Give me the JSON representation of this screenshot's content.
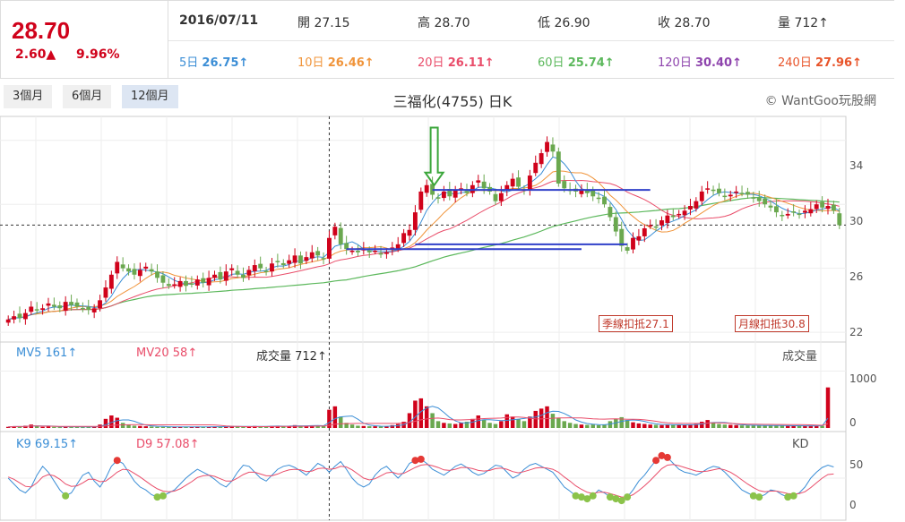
{
  "quote": {
    "price": "28.70",
    "change": "2.60▲",
    "percent": "9.96%"
  },
  "info": {
    "date": "2016/07/11",
    "open": "開 27.15",
    "high": "高 28.70",
    "low": "低 26.90",
    "close": "收 28.70",
    "volume": "量 712↑"
  },
  "ma": [
    {
      "label": "5日",
      "value": "26.75↑",
      "color": "#3b8ed6"
    },
    {
      "label": "10日",
      "value": "26.46↑",
      "color": "#f0943a"
    },
    {
      "label": "20日",
      "value": "26.11↑",
      "color": "#e94d6a"
    },
    {
      "label": "60日",
      "value": "25.74↑",
      "color": "#5cb85c"
    },
    {
      "label": "120日",
      "value": "30.40↑",
      "color": "#8e44ad"
    },
    {
      "label": "240日",
      "value": "27.96↑",
      "color": "#e8542a"
    }
  ],
  "tabs": [
    "3個月",
    "6個月",
    "12個月"
  ],
  "title": "三福化(4755) 日K",
  "brand": "© WantGoo玩股網",
  "notes": {
    "quarter": "季線扣抵27.1",
    "month": "月線扣抵30.8"
  },
  "volume_panel": {
    "mv5": "MV5 161↑",
    "mv20": "MV20 58↑",
    "vol": "成交量 712↑",
    "name": "成交量"
  },
  "kd_panel": {
    "k": "K9 69.15↑",
    "d": "D9 57.08↑",
    "name": "KD"
  },
  "colors": {
    "up": "#d0021b",
    "down": "#6aa84f",
    "annot": "#3140c9",
    "arrow": "#3aa63a"
  },
  "chart_data": {
    "type": "candlestick",
    "price_ticks": [
      "34",
      "30",
      "26",
      "22"
    ],
    "price_ylim": [
      21.5,
      35.5
    ],
    "volume_ticks": [
      "1000",
      "0"
    ],
    "kd_ticks": [
      "50",
      "0"
    ],
    "reference_price": 28.7,
    "close": [
      22.8,
      23.0,
      22.9,
      23.2,
      23.6,
      23.4,
      23.5,
      23.8,
      23.6,
      23.5,
      23.9,
      23.7,
      23.6,
      23.5,
      23.4,
      23.5,
      24.0,
      24.8,
      25.6,
      26.4,
      26.0,
      25.8,
      25.6,
      25.9,
      26.1,
      25.8,
      25.4,
      25.1,
      24.9,
      25.0,
      25.2,
      24.9,
      25.0,
      25.3,
      25.1,
      25.4,
      25.6,
      25.3,
      25.8,
      26.0,
      25.6,
      25.4,
      25.9,
      26.2,
      26.0,
      25.8,
      26.3,
      26.4,
      26.2,
      26.5,
      26.8,
      26.3,
      26.7,
      27.0,
      26.8,
      26.6,
      27.9,
      28.6,
      27.5,
      27.2,
      27.1,
      27.0,
      27.2,
      27.0,
      27.1,
      26.9,
      27.0,
      27.3,
      27.5,
      28.2,
      28.4,
      29.5,
      30.8,
      31.2,
      30.6,
      30.4,
      30.8,
      30.5,
      30.9,
      31.0,
      30.7,
      31.2,
      31.5,
      31.0,
      30.8,
      30.2,
      30.7,
      31.2,
      31.6,
      31.1,
      30.9,
      31.8,
      32.6,
      33.2,
      33.9,
      33.3,
      31.3,
      31.0,
      30.9,
      30.8,
      30.9,
      30.7,
      30.5,
      30.4,
      30.0,
      29.2,
      28.3,
      27.4,
      27.1,
      27.9,
      28.0,
      28.5,
      28.7,
      28.6,
      29.0,
      29.3,
      29.2,
      29.4,
      29.6,
      29.9,
      30.2,
      30.8,
      31.0,
      30.9,
      30.7,
      30.5,
      30.6,
      30.8,
      30.7,
      30.6,
      30.4,
      30.2,
      30.0,
      29.8,
      29.5,
      29.3,
      29.4,
      29.5,
      29.4,
      29.6,
      29.7,
      30.0,
      29.8,
      29.9,
      29.6,
      28.7
    ],
    "volume": [
      20,
      30,
      25,
      40,
      60,
      30,
      20,
      25,
      20,
      15,
      30,
      25,
      18,
      15,
      20,
      25,
      60,
      160,
      220,
      180,
      90,
      60,
      40,
      35,
      30,
      25,
      20,
      20,
      15,
      18,
      22,
      20,
      18,
      25,
      20,
      22,
      25,
      20,
      30,
      35,
      25,
      20,
      30,
      35,
      30,
      25,
      35,
      40,
      30,
      35,
      50,
      35,
      40,
      45,
      40,
      35,
      320,
      380,
      200,
      90,
      60,
      40,
      35,
      30,
      30,
      25,
      30,
      50,
      70,
      110,
      260,
      480,
      520,
      380,
      260,
      120,
      90,
      80,
      70,
      90,
      110,
      160,
      220,
      150,
      90,
      70,
      120,
      240,
      200,
      150,
      120,
      200,
      300,
      340,
      380,
      250,
      180,
      120,
      90,
      70,
      60,
      55,
      60,
      50,
      60,
      120,
      160,
      190,
      140,
      100,
      80,
      70,
      60,
      55,
      50,
      60,
      60,
      55,
      50,
      60,
      70,
      110,
      140,
      100,
      70,
      60,
      55,
      50,
      45,
      45,
      40,
      45,
      40,
      40,
      45,
      40,
      38,
      35,
      40,
      38,
      35,
      40,
      40,
      712
    ],
    "k": [
      50,
      40,
      30,
      25,
      35,
      55,
      70,
      60,
      45,
      30,
      20,
      25,
      40,
      55,
      60,
      45,
      35,
      50,
      70,
      80,
      75,
      60,
      45,
      35,
      30,
      22,
      18,
      20,
      25,
      30,
      40,
      50,
      58,
      65,
      60,
      55,
      48,
      40,
      35,
      45,
      60,
      72,
      70,
      60,
      50,
      45,
      55,
      65,
      70,
      72,
      68,
      62,
      55,
      65,
      75,
      70,
      60,
      70,
      78,
      65,
      50,
      40,
      35,
      40,
      55,
      65,
      70,
      60,
      50,
      60,
      75,
      80,
      82,
      75,
      65,
      60,
      55,
      62,
      70,
      74,
      68,
      60,
      55,
      58,
      65,
      72,
      70,
      60,
      50,
      55,
      65,
      72,
      75,
      70,
      65,
      60,
      48,
      35,
      28,
      20,
      18,
      15,
      20,
      30,
      25,
      18,
      15,
      12,
      18,
      30,
      45,
      55,
      68,
      80,
      88,
      85,
      75,
      65,
      60,
      58,
      55,
      60,
      66,
      70,
      68,
      60,
      50,
      40,
      30,
      25,
      20,
      18,
      22,
      30,
      28,
      22,
      18,
      20,
      25,
      35,
      50,
      60,
      68,
      72,
      69
    ],
    "d": [
      52,
      48,
      42,
      36,
      35,
      42,
      52,
      56,
      54,
      48,
      40,
      36,
      37,
      42,
      48,
      48,
      44,
      45,
      52,
      60,
      65,
      64,
      58,
      52,
      45,
      38,
      32,
      28,
      27,
      28,
      32,
      38,
      44,
      51,
      54,
      55,
      53,
      49,
      45,
      45,
      50,
      56,
      60,
      60,
      57,
      54,
      54,
      57,
      61,
      64,
      65,
      64,
      61,
      62,
      66,
      67,
      65,
      66,
      70,
      69,
      64,
      57,
      50,
      47,
      49,
      54,
      59,
      60,
      57,
      58,
      63,
      68,
      72,
      73,
      71,
      68,
      64,
      63,
      65,
      68,
      68,
      66,
      63,
      62,
      63,
      66,
      67,
      65,
      61,
      59,
      61,
      64,
      67,
      68,
      67,
      65,
      60,
      52,
      45,
      37,
      31,
      26,
      24,
      26,
      26,
      24,
      21,
      18,
      18,
      22,
      29,
      37,
      46,
      56,
      66,
      72,
      73,
      71,
      68,
      65,
      62,
      61,
      62,
      64,
      66,
      64,
      60,
      54,
      47,
      40,
      34,
      29,
      27,
      28,
      28,
      26,
      24,
      23,
      24,
      27,
      34,
      42,
      50,
      56,
      57
    ]
  }
}
